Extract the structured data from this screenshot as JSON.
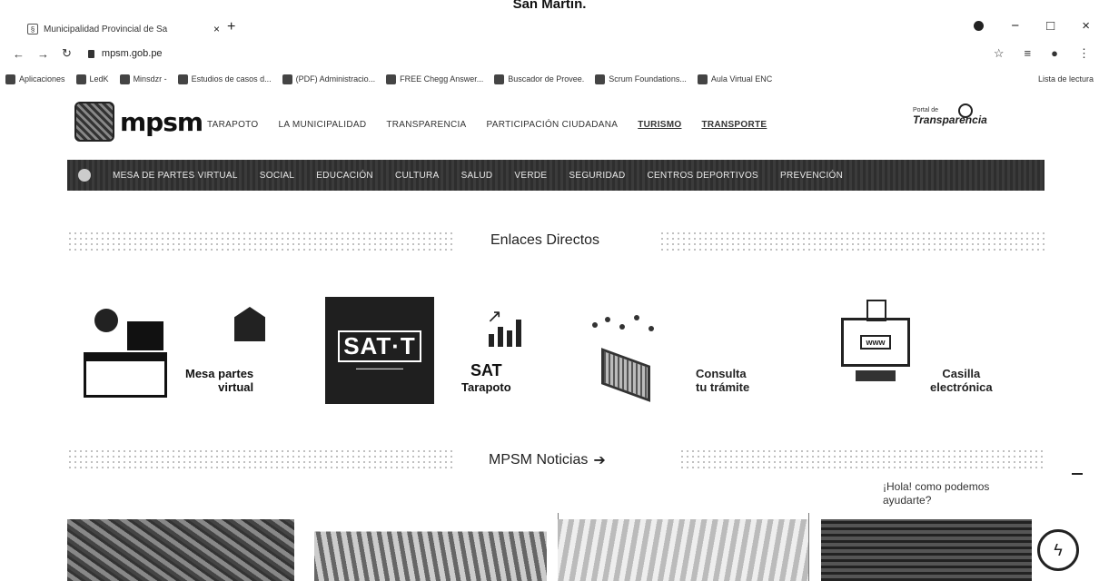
{
  "caption": "San Martin.",
  "browser": {
    "tab_title": "Municipalidad Provincial de Sa",
    "tab_close": "×",
    "new_tab": "+",
    "window_controls": {
      "minimize": "−",
      "maximize": "□",
      "close": "×"
    },
    "url": "mpsm.gob.pe",
    "bookmarks": [
      "Aplicaciones",
      "LedK",
      "Minsdzr -",
      "Estudios de casos d...",
      "(PDF) Administracio...",
      "FREE Chegg Answer...",
      "Buscador de Provee.",
      "Scrum Foundations...",
      "Aula Virtual ENC"
    ],
    "reading_list": "Lista de lectura"
  },
  "header": {
    "brand": "mpsm",
    "nav": [
      "TARAPOTO",
      "LA MUNICIPALIDAD",
      "TRANSPARENCIA",
      "PARTICIPACIÓN CIUDADANA",
      "TURISMO",
      "TRANSPORTE"
    ],
    "transparency_small": "Portal de",
    "transparency_big": "Transparencia"
  },
  "subnav": [
    "MESA DE PARTES VIRTUAL",
    "SOCIAL",
    "EDUCACIÓN",
    "CULTURA",
    "SALUD",
    "VERDE",
    "SEGURIDAD",
    "CENTROS DEPORTIVOS",
    "PREVENCIÓN"
  ],
  "sections": {
    "links_title": "Enlaces Directos",
    "news_title": "MPSM Noticias",
    "news_arrow": "➔"
  },
  "links": {
    "mesa": {
      "line1": "Mesa partes",
      "line2": "virtual"
    },
    "sat_box": "SAT·T",
    "sat": {
      "line1": "SAT",
      "line2": "Tarapoto"
    },
    "tramite": {
      "line1": "Consulta",
      "line2": "tu trámite"
    },
    "casilla": {
      "line1": "Casilla",
      "line2": "electrónica",
      "www": "www"
    }
  },
  "chat": {
    "greeting": "¡Hola! como podemos ayudarte?"
  }
}
